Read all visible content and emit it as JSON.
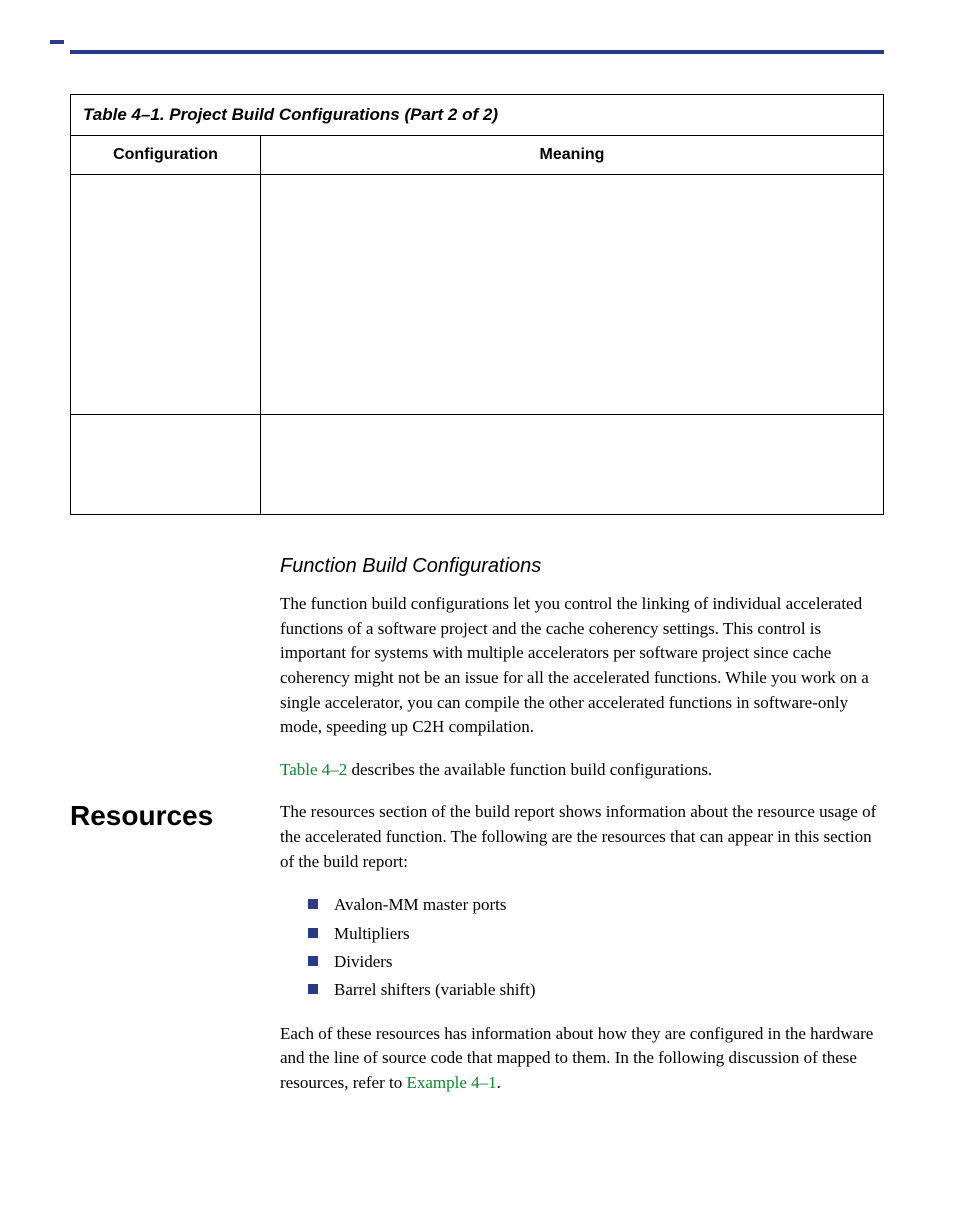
{
  "table": {
    "caption": "Table 4–1. Project Build Configurations  (Part 2 of 2)",
    "col1": "Configuration",
    "col2": "Meaning"
  },
  "section1": {
    "heading": "Function Build Configurations",
    "p1": "The function build configurations let you control the linking of individual accelerated functions of a software project and the cache coherency settings. This control is important for systems with multiple accelerators per software project since cache coherency might not be an issue for all the accelerated functions. While you work on a single accelerator, you can compile the other accelerated functions in software-only mode, speeding up C2H compilation.",
    "p2_ref": "Table 4–2",
    "p2_rest": " describes the available function build configurations."
  },
  "resources": {
    "heading": "Resources",
    "p1": "The resources section of the build report shows information about the resource usage of the accelerated function. The following are the resources that can appear in this section of the build report:",
    "items": [
      "Avalon-MM master ports",
      "Multipliers",
      "Dividers",
      "Barrel shifters (variable shift)"
    ],
    "p2_a": "Each of these resources has information about how they are configured in the hardware and the line of source code that mapped to them. In the following discussion of these resources, refer to ",
    "p2_ref": "Example 4–1",
    "p2_b": "."
  }
}
